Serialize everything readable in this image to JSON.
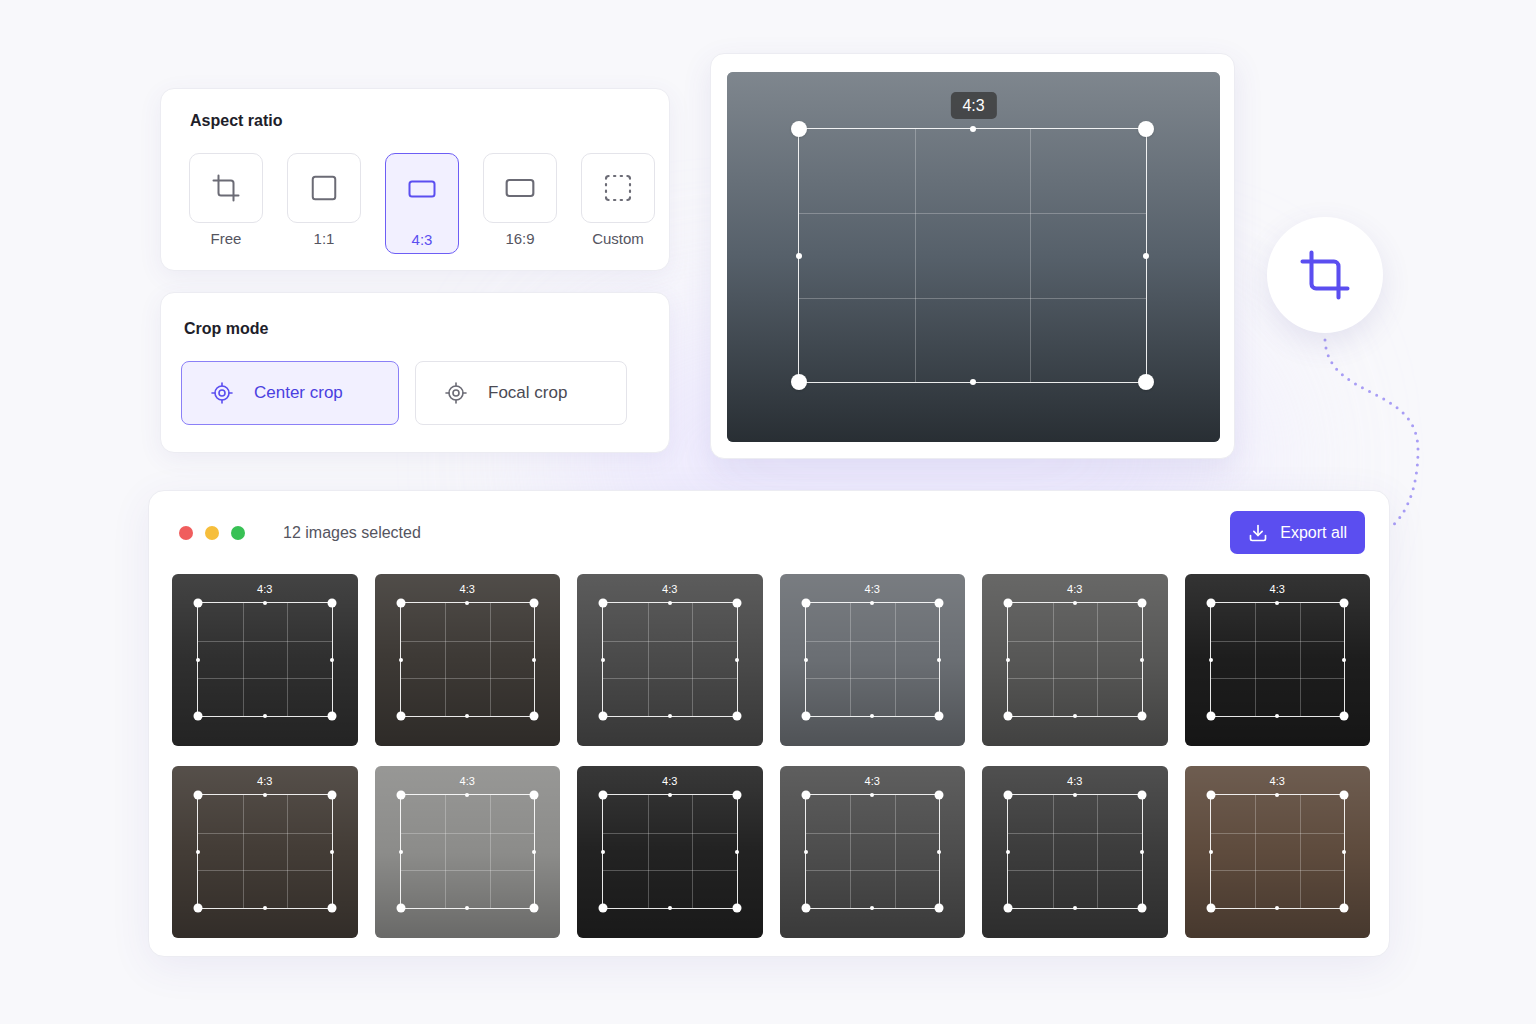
{
  "aspect_ratio": {
    "title": "Aspect ratio",
    "options": [
      {
        "label": "Free",
        "selected": false
      },
      {
        "label": "1:1",
        "selected": false
      },
      {
        "label": "4:3",
        "selected": true
      },
      {
        "label": "16:9",
        "selected": false
      },
      {
        "label": "Custom",
        "selected": false
      }
    ]
  },
  "crop_mode": {
    "title": "Crop mode",
    "options": [
      {
        "label": "Center crop",
        "selected": true
      },
      {
        "label": "Focal crop",
        "selected": false
      }
    ]
  },
  "preview": {
    "badge": "4:3",
    "color": "#56606a"
  },
  "gallery": {
    "selected_count": "12 images selected",
    "export_button": "Export all",
    "images": [
      {
        "badge": "4:3",
        "color": "#2f2f2f"
      },
      {
        "badge": "4:3",
        "color": "#3d3935"
      },
      {
        "badge": "4:3",
        "color": "#4a4a4a"
      },
      {
        "badge": "4:3",
        "color": "#6a6e73"
      },
      {
        "badge": "4:3",
        "color": "#575756"
      },
      {
        "badge": "4:3",
        "color": "#1d1d1d"
      },
      {
        "badge": "4:3",
        "color": "#433c36"
      },
      {
        "badge": "4:3",
        "color": "#8c8c8a"
      },
      {
        "badge": "4:3",
        "color": "#222222"
      },
      {
        "badge": "4:3",
        "color": "#4d4d4d"
      },
      {
        "badge": "4:3",
        "color": "#3c3c3c"
      },
      {
        "badge": "4:3",
        "color": "#5e4b3d"
      }
    ]
  }
}
